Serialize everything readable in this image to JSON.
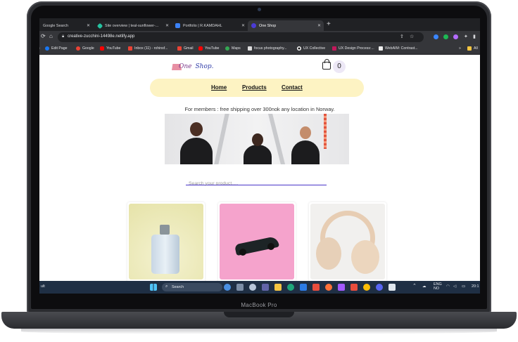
{
  "device": {
    "label": "MacBook Pro"
  },
  "browser": {
    "tabs": [
      {
        "label": "Google Search",
        "icon": "google-icon",
        "color": "#4285f4"
      },
      {
        "label": "Site overview | teal-sunflower-...",
        "icon": "netlify-icon",
        "color": "#25c2a0"
      },
      {
        "label": "Portfolio | R.KAMDAHL",
        "icon": "portfolio-icon",
        "color": "#3b82f6"
      },
      {
        "label": "One Shop",
        "icon": "shop-icon",
        "color": "#4b3bd6"
      }
    ],
    "url": "creative-zucchini-14498e.netlify.app",
    "bookmarks": [
      {
        "label": "Edit Page",
        "color": "#1877f2"
      },
      {
        "label": "Google",
        "color": "#ea4335"
      },
      {
        "label": "YouTube",
        "color": "#ff0000"
      },
      {
        "label": "Inbox (11) - rohinsf...",
        "color": "#ea4335"
      },
      {
        "label": "Gmail",
        "color": "#ea4335"
      },
      {
        "label": "YouTube",
        "color": "#ff0000"
      },
      {
        "label": "Maps",
        "color": "#34a853"
      },
      {
        "label": "focus photography...",
        "color": "#dddddd"
      },
      {
        "label": "UX Collective",
        "color": "#222222"
      },
      {
        "label": "UX Design Process:...",
        "color": "#c2185b"
      },
      {
        "label": "WebAIM: Contrast...",
        "color": "#eeeeee"
      }
    ],
    "bookmarks_more": "All"
  },
  "site": {
    "logo_one": "One",
    "logo_shop": "Shop.",
    "cart_count": "0",
    "nav": [
      {
        "label": "Home"
      },
      {
        "label": "Products"
      },
      {
        "label": "Contact"
      }
    ],
    "promo": "For members : free shipping over 300nok any location in Norway.",
    "search_placeholder": "Search your product.....",
    "products": [
      {
        "name": "perfume-bottle",
        "bg": "#ecebbd"
      },
      {
        "name": "toy-car",
        "bg": "#f6a9cf"
      },
      {
        "name": "headphones",
        "bg": "#efefef"
      }
    ]
  },
  "taskbar": {
    "search_label": "Search",
    "language": "ENG",
    "region": "NO",
    "time": "20:1",
    "left_text": "ult"
  }
}
